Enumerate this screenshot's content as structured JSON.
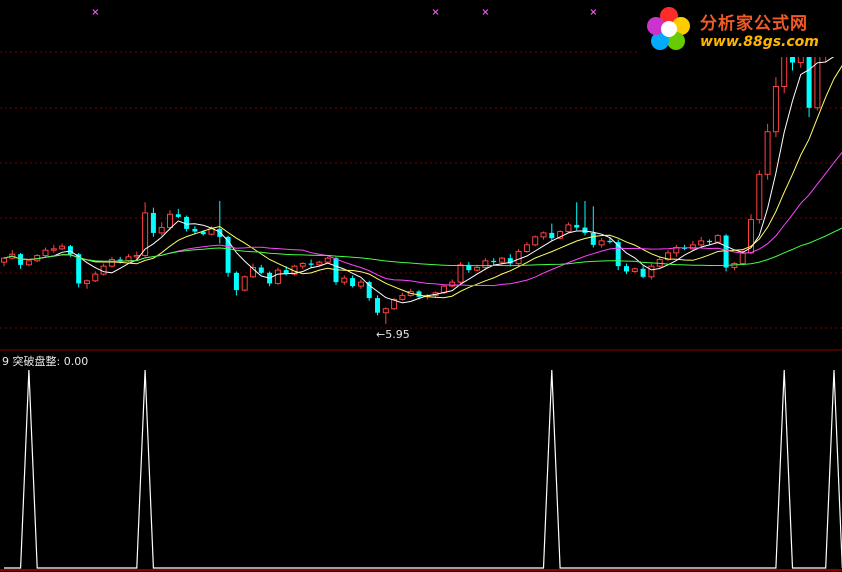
{
  "indicator": {
    "name": "突破盘整",
    "value": "0.00",
    "prefix": "9"
  },
  "low_marker": {
    "text": "5.95",
    "arrow": "←"
  },
  "logo": {
    "title": "分析家公式网",
    "url": "www.88gs.com"
  },
  "colors": {
    "background": "#000000",
    "up_candle": "#ff4040",
    "down_candle": "#00ffff",
    "ma5": "#ffffff",
    "ma10": "#ffff66",
    "ma20": "#ff44ff",
    "ma60": "#44ff44",
    "grid": "#7a0000",
    "indicator_line": "#ffffff",
    "signal_marker": "#ff55ff"
  },
  "chart_data": [
    {
      "type": "candlestick",
      "title": "",
      "price_axis": {
        "visible": false,
        "min_price_on_chart": 5.95
      },
      "ohlc": [
        [
          10.6,
          11.0,
          10.3,
          10.9
        ],
        [
          10.9,
          11.5,
          10.8,
          11.2
        ],
        [
          11.2,
          11.3,
          10.1,
          10.4
        ],
        [
          10.4,
          10.8,
          10.3,
          10.7
        ],
        [
          10.7,
          11.2,
          10.6,
          11.1
        ],
        [
          11.1,
          11.7,
          11.0,
          11.5
        ],
        [
          11.5,
          11.9,
          11.3,
          11.6
        ],
        [
          11.6,
          12.0,
          11.5,
          11.8
        ],
        [
          11.8,
          11.9,
          11.0,
          11.2
        ],
        [
          11.2,
          11.3,
          8.7,
          9.0
        ],
        [
          9.0,
          9.3,
          8.6,
          9.2
        ],
        [
          9.2,
          9.9,
          9.1,
          9.7
        ],
        [
          9.7,
          10.5,
          9.6,
          10.3
        ],
        [
          10.3,
          11.0,
          10.2,
          10.8
        ],
        [
          10.8,
          11.0,
          10.5,
          10.7
        ],
        [
          10.7,
          11.2,
          10.6,
          11.0
        ],
        [
          11.0,
          11.4,
          10.8,
          11.1
        ],
        [
          11.1,
          15.1,
          11.0,
          14.3
        ],
        [
          14.3,
          14.7,
          12.5,
          12.8
        ],
        [
          12.8,
          13.6,
          12.6,
          13.2
        ],
        [
          13.2,
          14.5,
          13.0,
          14.2
        ],
        [
          14.2,
          14.6,
          13.9,
          14.0
        ],
        [
          14.0,
          14.1,
          12.9,
          13.1
        ],
        [
          13.1,
          13.3,
          12.7,
          12.9
        ],
        [
          12.9,
          13.0,
          12.6,
          12.7
        ],
        [
          12.7,
          13.3,
          12.6,
          13.1
        ],
        [
          13.1,
          15.2,
          12.0,
          12.5
        ],
        [
          12.5,
          12.6,
          9.5,
          9.8
        ],
        [
          9.8,
          9.9,
          8.1,
          8.5
        ],
        [
          8.5,
          9.6,
          8.4,
          9.5
        ],
        [
          9.5,
          10.5,
          9.4,
          10.2
        ],
        [
          10.2,
          10.4,
          9.7,
          9.8
        ],
        [
          9.8,
          9.9,
          8.8,
          9.0
        ],
        [
          9.0,
          10.2,
          8.9,
          10.0
        ],
        [
          10.0,
          10.3,
          9.6,
          9.7
        ],
        [
          9.7,
          10.4,
          9.6,
          10.3
        ],
        [
          10.3,
          10.6,
          10.1,
          10.5
        ],
        [
          10.5,
          10.8,
          10.2,
          10.4
        ],
        [
          10.4,
          10.7,
          10.3,
          10.6
        ],
        [
          10.6,
          11.0,
          10.5,
          10.9
        ],
        [
          10.9,
          11.0,
          8.9,
          9.1
        ],
        [
          9.1,
          9.6,
          8.9,
          9.4
        ],
        [
          9.4,
          9.6,
          8.7,
          8.8
        ],
        [
          8.8,
          9.3,
          8.6,
          9.1
        ],
        [
          9.1,
          9.2,
          7.7,
          7.9
        ],
        [
          7.9,
          8.1,
          6.6,
          6.8
        ],
        [
          6.8,
          7.2,
          5.95,
          7.1
        ],
        [
          7.1,
          7.9,
          7.0,
          7.8
        ],
        [
          7.8,
          8.3,
          7.7,
          8.1
        ],
        [
          8.1,
          8.6,
          8.0,
          8.4
        ],
        [
          8.4,
          8.5,
          7.8,
          8.0
        ],
        [
          8.0,
          8.2,
          7.8,
          8.1
        ],
        [
          8.1,
          8.4,
          7.9,
          8.3
        ],
        [
          8.3,
          8.9,
          8.2,
          8.8
        ],
        [
          8.8,
          9.3,
          8.7,
          9.1
        ],
        [
          9.1,
          10.6,
          9.0,
          10.4
        ],
        [
          10.4,
          10.6,
          9.8,
          10.0
        ],
        [
          10.0,
          10.4,
          9.9,
          10.2
        ],
        [
          10.2,
          10.9,
          10.0,
          10.7
        ],
        [
          10.7,
          10.9,
          10.4,
          10.6
        ],
        [
          10.6,
          11.0,
          10.5,
          10.9
        ],
        [
          10.9,
          11.2,
          10.3,
          10.5
        ],
        [
          10.5,
          11.6,
          10.4,
          11.4
        ],
        [
          11.4,
          12.1,
          11.3,
          11.9
        ],
        [
          11.9,
          12.6,
          11.8,
          12.5
        ],
        [
          12.5,
          12.9,
          12.3,
          12.8
        ],
        [
          12.8,
          13.5,
          12.2,
          12.4
        ],
        [
          12.4,
          13.0,
          12.3,
          12.9
        ],
        [
          12.9,
          13.6,
          12.8,
          13.4
        ],
        [
          13.4,
          15.1,
          13.0,
          13.2
        ],
        [
          13.2,
          15.2,
          12.6,
          12.8
        ],
        [
          12.8,
          14.8,
          11.7,
          11.9
        ],
        [
          11.9,
          12.4,
          11.7,
          12.2
        ],
        [
          12.2,
          12.5,
          12.0,
          12.1
        ],
        [
          12.1,
          12.3,
          10.0,
          10.3
        ],
        [
          10.3,
          10.5,
          9.7,
          9.9
        ],
        [
          9.9,
          10.2,
          9.8,
          10.1
        ],
        [
          10.1,
          10.3,
          9.4,
          9.5
        ],
        [
          9.5,
          10.5,
          9.3,
          10.3
        ],
        [
          10.3,
          11.0,
          10.2,
          10.8
        ],
        [
          10.8,
          11.5,
          10.7,
          11.3
        ],
        [
          11.3,
          11.9,
          11.0,
          11.7
        ],
        [
          11.7,
          11.9,
          11.5,
          11.6
        ],
        [
          11.6,
          12.2,
          11.5,
          11.9
        ],
        [
          11.9,
          12.5,
          11.8,
          12.2
        ],
        [
          12.2,
          12.3,
          11.9,
          12.1
        ],
        [
          12.1,
          12.7,
          12.0,
          12.6
        ],
        [
          12.6,
          12.7,
          9.9,
          10.2
        ],
        [
          10.2,
          10.6,
          10.0,
          10.5
        ],
        [
          10.5,
          11.5,
          10.4,
          11.3
        ],
        [
          11.3,
          14.2,
          11.2,
          13.8
        ],
        [
          13.8,
          17.5,
          13.5,
          17.2
        ],
        [
          17.2,
          21.0,
          16.8,
          20.4
        ],
        [
          20.4,
          24.5,
          20.0,
          23.8
        ],
        [
          23.8,
          27.0,
          23.3,
          26.6
        ],
        [
          26.6,
          27.3,
          25.0,
          25.6
        ],
        [
          25.6,
          27.6,
          25.2,
          27.1
        ],
        [
          27.1,
          27.5,
          21.5,
          22.2
        ],
        [
          22.2,
          26.9,
          22.0,
          26.4
        ],
        [
          26.4,
          27.5,
          25.6,
          26.9
        ],
        [
          26.9,
          28.0,
          26.0,
          27.7
        ],
        [
          27.7,
          28.2,
          26.8,
          27.2
        ]
      ],
      "moving_averages": [
        {
          "name": "MA5"
        },
        {
          "name": "MA10"
        },
        {
          "name": "MA20"
        },
        {
          "name": "MA60"
        }
      ]
    },
    {
      "type": "line",
      "title": "突破盘整",
      "series": [
        {
          "name": "突破盘整",
          "values": [
            0,
            0,
            0,
            1,
            0,
            0,
            0,
            0,
            0,
            0,
            0,
            0,
            0,
            0,
            0,
            0,
            0,
            1,
            0,
            0,
            0,
            0,
            0,
            0,
            0,
            0,
            0,
            0,
            0,
            0,
            0,
            0,
            0,
            0,
            0,
            0,
            0,
            0,
            0,
            0,
            0,
            0,
            0,
            0,
            0,
            0,
            0,
            0,
            0,
            0,
            0,
            0,
            0,
            0,
            0,
            0,
            0,
            0,
            0,
            0,
            0,
            0,
            0,
            0,
            0,
            0,
            1,
            0,
            0,
            0,
            0,
            0,
            0,
            0,
            0,
            0,
            0,
            0,
            0,
            0,
            0,
            0,
            0,
            0,
            0,
            0,
            0,
            0,
            0,
            0,
            0,
            0,
            0,
            0,
            1,
            0,
            0,
            0,
            0,
            0,
            1,
            0
          ]
        }
      ],
      "ylim": [
        0,
        1
      ],
      "top_signal_markers": [
        11,
        52,
        58,
        71
      ]
    }
  ]
}
